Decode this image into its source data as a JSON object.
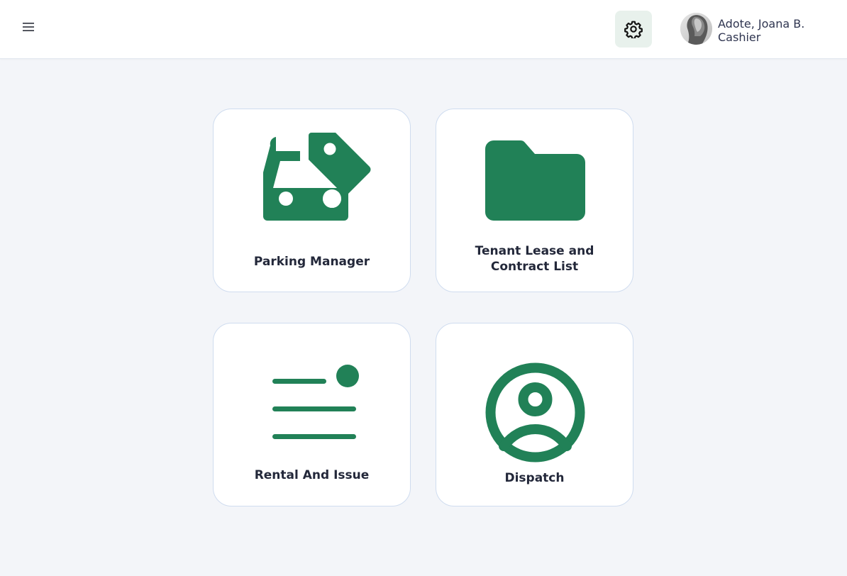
{
  "header": {
    "menu_icon": "hamburger-menu-icon",
    "settings_icon": "gear-icon",
    "user": {
      "name": "Adote, Joana B.",
      "role": "Cashier"
    }
  },
  "colors": {
    "brand_green": "#218157",
    "settings_bg": "#e8f1ec",
    "page_bg": "#f3f5f9",
    "card_border": "#cfdcef",
    "text_dark": "#23283a"
  },
  "modules": [
    {
      "label": "Parking Manager",
      "icon": "car-tag-icon"
    },
    {
      "label": "Tenant Lease and Contract List",
      "icon": "folder-icon"
    },
    {
      "label": "Rental And Issue",
      "icon": "list-notification-icon"
    },
    {
      "label": "Dispatch",
      "icon": "user-circle-icon"
    }
  ]
}
